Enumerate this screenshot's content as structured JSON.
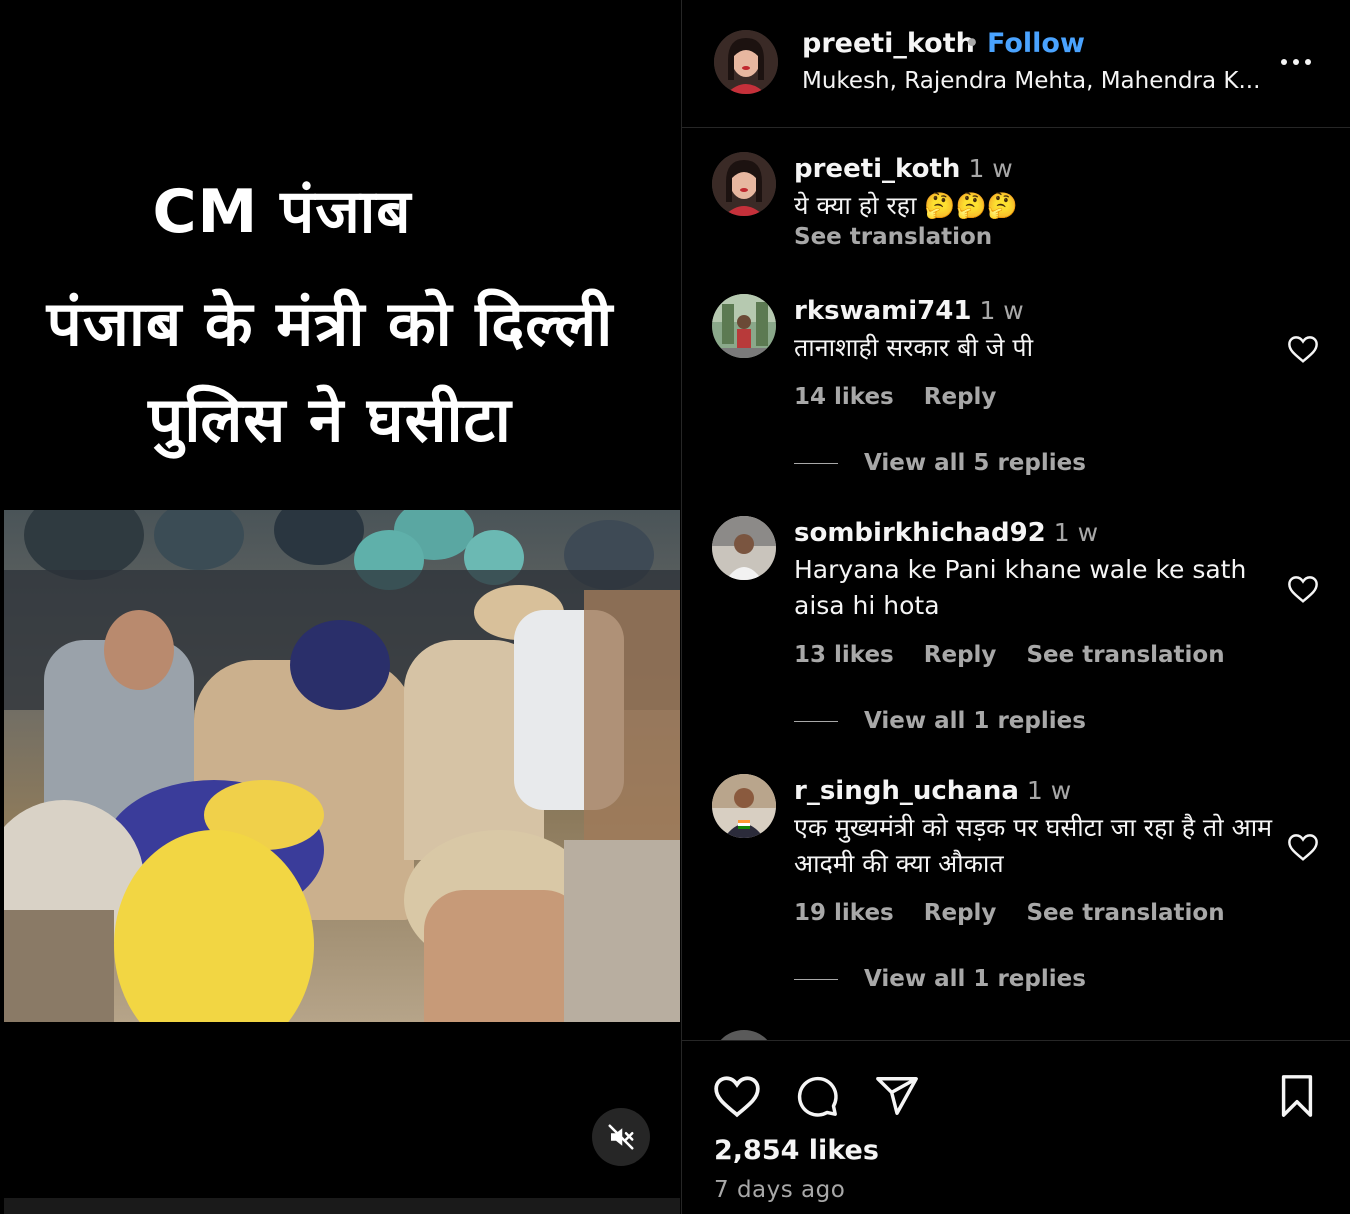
{
  "media": {
    "caption_line1": "CM पंजाब",
    "caption_line2": "पंजाब के मंत्री को दिल्ली",
    "caption_line3": "पुलिस ने घसीटा",
    "mute_icon": "speaker-muted-icon"
  },
  "header": {
    "username": "preeti_koth",
    "separator": "•",
    "follow_label": "Follow",
    "subtitle": "Mukesh, Rajendra Mehta, Mahendra K...",
    "more_icon": "more-options-icon"
  },
  "comments": [
    {
      "username": "preeti_koth",
      "time": "1 w",
      "text": "ये क्या हो रहा 🤔🤔🤔",
      "see_translation": "See translation"
    },
    {
      "username": "rkswami741",
      "time": "1 w",
      "text": "तानाशाही सरकार बी जे पी",
      "likes": "14 likes",
      "reply": "Reply",
      "view_replies": "View all 5 replies"
    },
    {
      "username": "sombirkhichad92",
      "time": "1 w",
      "text": "Haryana ke Pani khane wale ke sath aisa hi hota",
      "likes": "13 likes",
      "reply": "Reply",
      "see_translation": "See translation",
      "view_replies": "View all 1 replies"
    },
    {
      "username": "r_singh_uchana",
      "time": "1 w",
      "text": "एक मुख्यमंत्री को सड़क पर घसीटा जा रहा है तो आम आदमी की क्या औकात",
      "likes": "19 likes",
      "reply": "Reply",
      "see_translation": "See translation",
      "view_replies": "View all 1 replies"
    }
  ],
  "actions": {
    "likes": "2,854 likes",
    "posted": "7 days ago",
    "icons": [
      "heart-icon",
      "comment-icon",
      "share-icon",
      "bookmark-icon"
    ]
  },
  "colors": {
    "background": "#000000",
    "text": "#f5f5f5",
    "secondary_text": "#a8a8a8",
    "link": "#4aa3ff",
    "divider": "#262626"
  }
}
